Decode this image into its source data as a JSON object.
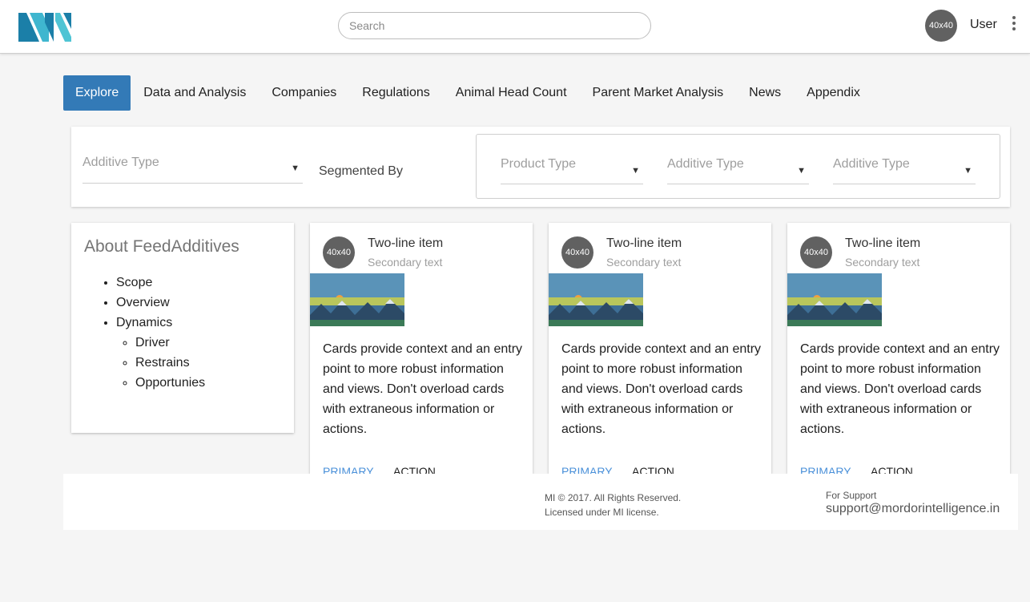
{
  "header": {
    "search_placeholder": "Search",
    "avatar_text": "40x40",
    "user_name": "User"
  },
  "tabs": [
    {
      "label": "Explore",
      "active": true
    },
    {
      "label": "Data and Analysis"
    },
    {
      "label": "Companies"
    },
    {
      "label": "Regulations"
    },
    {
      "label": "Animal Head Count"
    },
    {
      "label": "Parent Market Analysis"
    },
    {
      "label": "News"
    },
    {
      "label": "Appendix"
    }
  ],
  "filters": {
    "primary_select": "Additive Type",
    "segmented_by_label": "Segmented By",
    "segments": [
      "Product Type",
      "Additive Type",
      "Additive Type"
    ]
  },
  "about": {
    "title": "About FeedAdditives",
    "items": [
      "Scope",
      "Overview",
      "Dynamics"
    ],
    "sub_items": [
      "Driver",
      "Restrains",
      "Opportunies"
    ]
  },
  "cards": [
    {
      "avatar": "40x40",
      "title": "Two-line item",
      "subtitle": "Secondary text",
      "text": "Cards provide context and an entry point to more robust information and views. Don't overload cards with extraneous information or actions.",
      "primary": "PRIMARY",
      "action": "ACTION"
    },
    {
      "avatar": "40x40",
      "title": "Two-line item",
      "subtitle": "Secondary text",
      "text": "Cards provide context and an entry point to more robust information and views. Don't overload cards with extraneous information or actions.",
      "primary": "PRIMARY",
      "action": "ACTION"
    },
    {
      "avatar": "40x40",
      "title": "Two-line item",
      "subtitle": "Secondary text",
      "text": "Cards provide context and an entry point to more robust information and views. Don't overload cards with extraneous information or actions.",
      "primary": "PRIMARY",
      "action": "ACTION"
    }
  ],
  "footer": {
    "copyright": "MI © 2017. All Rights Reserved.",
    "license": "Licensed under MI license.",
    "support_label": "For Support",
    "support_email": "support@mordorintelligence.in"
  },
  "colors": {
    "accent": "#337ab7",
    "logo_dark": "#1b7fa8",
    "logo_light": "#4fc4d4",
    "link": "#4a90d9"
  },
  "icons": [
    "logo-icon",
    "kebab-menu-icon",
    "dropdown-caret-icon",
    "landscape-image-icon"
  ]
}
